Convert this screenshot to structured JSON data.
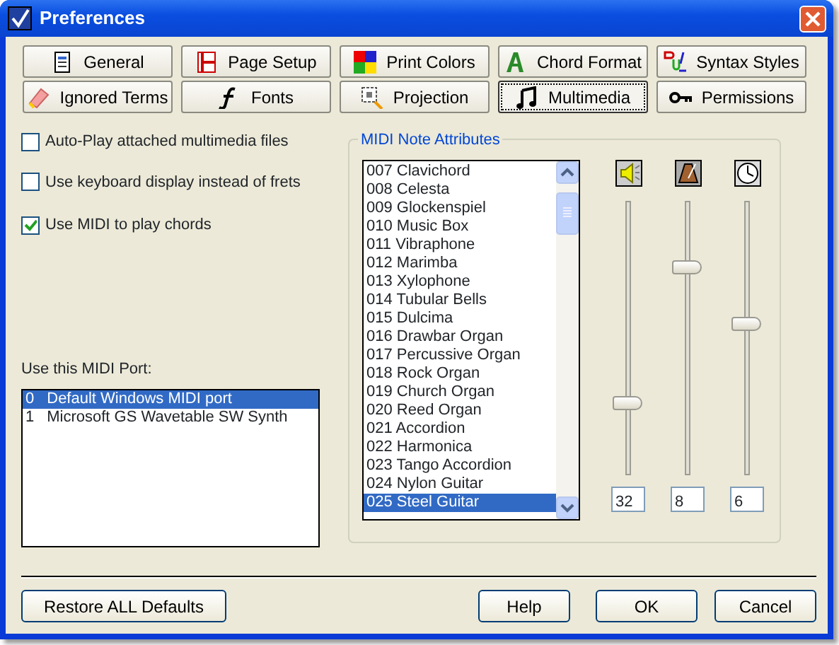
{
  "window": {
    "title": "Preferences"
  },
  "tabs": [
    {
      "label": "General",
      "selected": false
    },
    {
      "label": "Page Setup",
      "selected": false
    },
    {
      "label": "Print Colors",
      "selected": false
    },
    {
      "label": "Chord Format",
      "selected": false
    },
    {
      "label": "Syntax Styles",
      "selected": false
    },
    {
      "label": "Ignored Terms",
      "selected": false
    },
    {
      "label": "Fonts",
      "selected": false
    },
    {
      "label": "Projection",
      "selected": false
    },
    {
      "label": "Multimedia",
      "selected": true
    },
    {
      "label": "Permissions",
      "selected": false
    }
  ],
  "options": [
    {
      "label": "Auto-Play attached multimedia files",
      "checked": false
    },
    {
      "label": "Use keyboard display instead of frets",
      "checked": false
    },
    {
      "label": "Use MIDI to play chords",
      "checked": true
    }
  ],
  "midi_port": {
    "label": "Use this MIDI Port:",
    "items": [
      {
        "number": "0",
        "name": "Default Windows MIDI port",
        "selected": true
      },
      {
        "number": "1",
        "name": "Microsoft GS Wavetable SW Synth",
        "selected": false
      }
    ]
  },
  "midi_note_attributes": {
    "title": "MIDI Note Attributes",
    "instruments": [
      {
        "label": "007 Clavichord",
        "selected": false
      },
      {
        "label": "008 Celesta",
        "selected": false
      },
      {
        "label": "009 Glockenspiel",
        "selected": false
      },
      {
        "label": "010 Music Box",
        "selected": false
      },
      {
        "label": "011 Vibraphone",
        "selected": false
      },
      {
        "label": "012 Marimba",
        "selected": false
      },
      {
        "label": "013 Xylophone",
        "selected": false
      },
      {
        "label": "014 Tubular Bells",
        "selected": false
      },
      {
        "label": "015 Dulcima",
        "selected": false
      },
      {
        "label": "016 Drawbar Organ",
        "selected": false
      },
      {
        "label": "017 Percussive Organ",
        "selected": false
      },
      {
        "label": "018 Rock Organ",
        "selected": false
      },
      {
        "label": "019 Church Organ",
        "selected": false
      },
      {
        "label": "020 Reed Organ",
        "selected": false
      },
      {
        "label": "021 Accordion",
        "selected": false
      },
      {
        "label": "022 Harmonica",
        "selected": false
      },
      {
        "label": "023 Tango Accordion",
        "selected": false
      },
      {
        "label": "024 Nylon Guitar",
        "selected": false
      },
      {
        "label": "025 Steel Guitar",
        "selected": true
      }
    ],
    "sliders": [
      {
        "level": 0.26,
        "value": "32"
      },
      {
        "level": 0.76,
        "value": "8"
      },
      {
        "level": 0.55,
        "value": "6"
      }
    ]
  },
  "buttons": {
    "restore": "Restore ALL Defaults",
    "actions": [
      "Help",
      "OK",
      "Cancel"
    ]
  }
}
